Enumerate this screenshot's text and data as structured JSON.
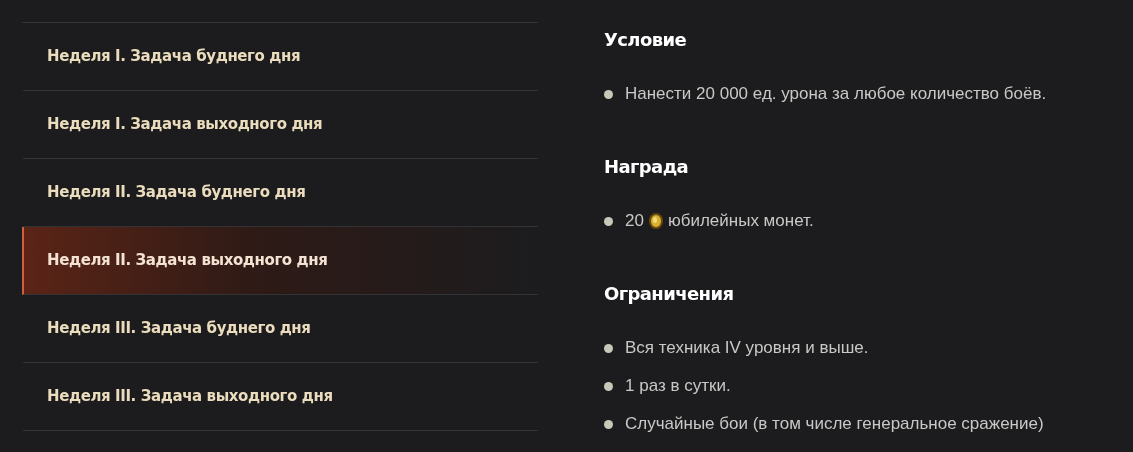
{
  "tasks": [
    {
      "label": "Неделя I. Задача буднего дня",
      "selected": false
    },
    {
      "label": "Неделя I. Задача выходного дня",
      "selected": false
    },
    {
      "label": "Неделя II. Задача буднего дня",
      "selected": false
    },
    {
      "label": "Неделя II. Задача выходного дня",
      "selected": true
    },
    {
      "label": "Неделя III. Задача буднего дня",
      "selected": false
    },
    {
      "label": "Неделя III. Задача выходного дня",
      "selected": false
    }
  ],
  "sections": [
    {
      "title": "Условие",
      "items": [
        {
          "kind": "text",
          "text": "Нанести 20 000 ед. урона за любое количество боёв."
        }
      ]
    },
    {
      "title": "Награда",
      "items": [
        {
          "kind": "coin",
          "amount": "20",
          "text": "юбилейных монет."
        }
      ]
    },
    {
      "title": "Ограничения",
      "items": [
        {
          "kind": "text",
          "text": "Вся техника IV уровня и выше."
        },
        {
          "kind": "text",
          "text": "1 раз в сутки."
        },
        {
          "kind": "text",
          "text": "Случайные бои (в том числе генеральное сражение)"
        }
      ]
    }
  ]
}
